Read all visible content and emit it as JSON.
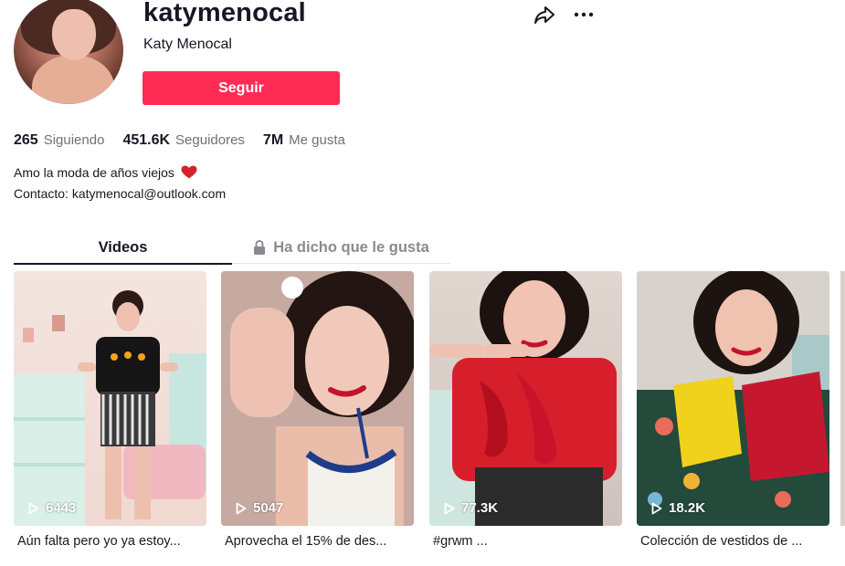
{
  "profile": {
    "username": "katymenocal",
    "nickname": "Katy Menocal",
    "follow_label": "Seguir"
  },
  "stats": [
    {
      "value": "265",
      "label": "Siguiendo"
    },
    {
      "value": "451.6K",
      "label": "Seguidores"
    },
    {
      "value": "7M",
      "label": "Me gusta"
    }
  ],
  "bio": {
    "line1": "Amo la moda de años viejos",
    "line2": "Contacto: katymenocal@outlook.com"
  },
  "tabs": [
    {
      "label": "Videos",
      "active": true
    },
    {
      "label": "Ha dicho que le gusta",
      "active": false,
      "icon": "lock-icon"
    }
  ],
  "videos": [
    {
      "views": "6443",
      "caption": "Aún falta pero yo ya estoy..."
    },
    {
      "views": "5047",
      "caption": "Aprovecha el 15% de des..."
    },
    {
      "views": "77.3K",
      "caption": "#grwm ..."
    },
    {
      "views": "18.2K",
      "caption": "Colección de vestidos de ..."
    }
  ],
  "colors": {
    "accent": "#fe2c55",
    "text": "#161823",
    "muted": "#6f7079"
  }
}
